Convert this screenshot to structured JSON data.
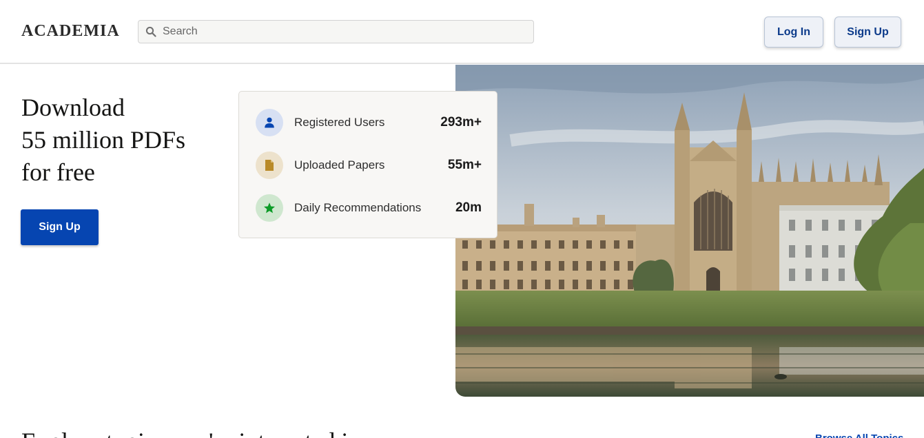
{
  "header": {
    "logo": "ACADEMIA",
    "search_placeholder": "Search",
    "login_label": "Log In",
    "signup_label": "Sign Up"
  },
  "hero": {
    "headline_lines": [
      "Download",
      "55 million PDFs",
      "for free"
    ],
    "signup_label": "Sign Up"
  },
  "stats": [
    {
      "icon": "user-icon",
      "label": "Registered Users",
      "value": "293m+",
      "icon_bg": "#d7e0f3",
      "icon_color": "#0645b1"
    },
    {
      "icon": "document-icon",
      "label": "Uploaded Papers",
      "value": "55m+",
      "icon_bg": "#ede2cc",
      "icon_color": "#b98a28"
    },
    {
      "icon": "star-icon",
      "label": "Daily Recommendations",
      "value": "20m",
      "icon_bg": "#cfe7cf",
      "icon_color": "#0c9b27"
    }
  ],
  "bottom": {
    "section_title": "Explore topics you're interested in",
    "browse_link": "Browse All Topics"
  },
  "colors": {
    "brand_blue": "#0645b1",
    "card_bg": "#f8f7f5",
    "header_border": "#e3e3e3"
  }
}
